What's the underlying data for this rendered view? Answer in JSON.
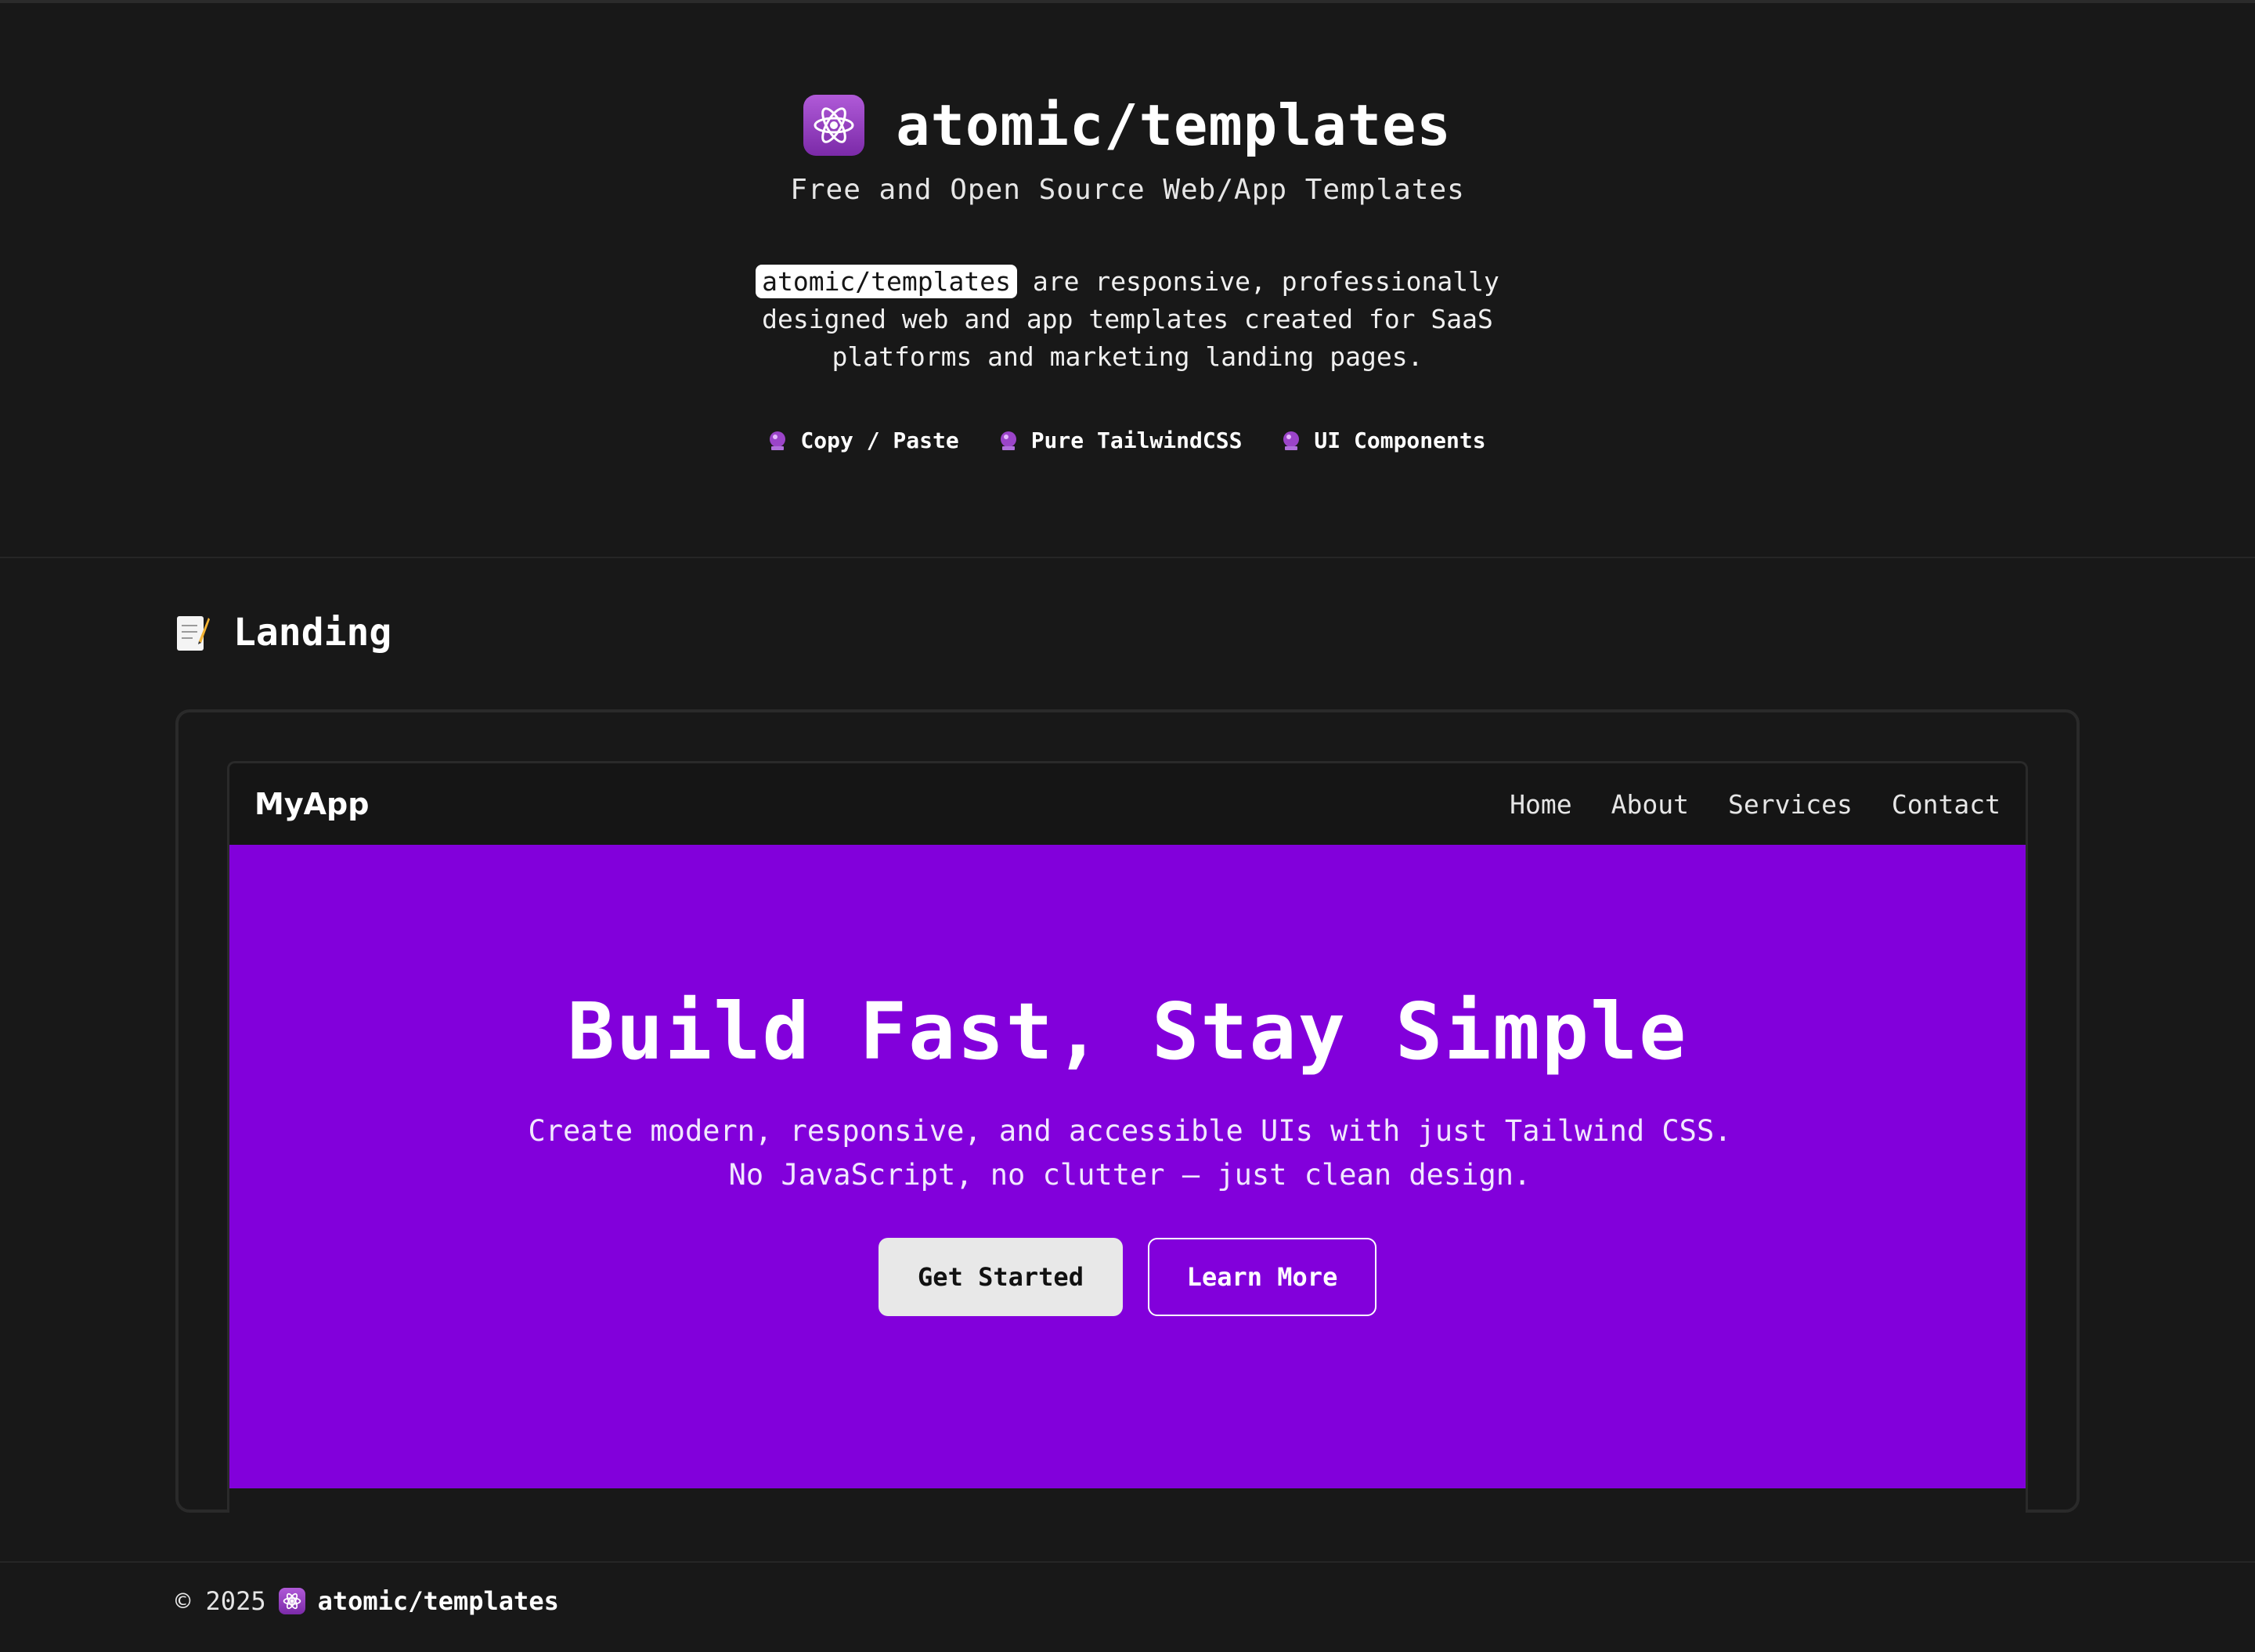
{
  "site": {
    "title": "atomic/templates",
    "tagline": "Free and Open Source Web/App Templates",
    "description_chip": "atomic/templates",
    "description_rest": " are responsive, professionally designed web and app templates created for SaaS platforms and marketing landing pages.",
    "features": [
      {
        "label": "Copy / Paste",
        "icon": "gem-icon"
      },
      {
        "label": "Pure TailwindCSS",
        "icon": "gem-icon"
      },
      {
        "label": "UI Components",
        "icon": "gem-icon"
      }
    ]
  },
  "section": {
    "title": "Landing",
    "icon": "memo-icon"
  },
  "preview": {
    "brand": "MyApp",
    "nav": [
      "Home",
      "About",
      "Services",
      "Contact"
    ],
    "hero_title": "Build Fast, Stay Simple",
    "hero_subtitle": "Create modern, responsive, and accessible UIs with just Tailwind CSS. No JavaScript, no clutter — just clean design.",
    "primary_button": "Get Started",
    "secondary_button": "Learn More",
    "hero_color": "#8200db"
  },
  "footer": {
    "copyright": "© 2025",
    "brand": "atomic/templates"
  },
  "colors": {
    "background": "#181818",
    "accent": "#8200db",
    "badge_purple": "#9b44c9"
  }
}
